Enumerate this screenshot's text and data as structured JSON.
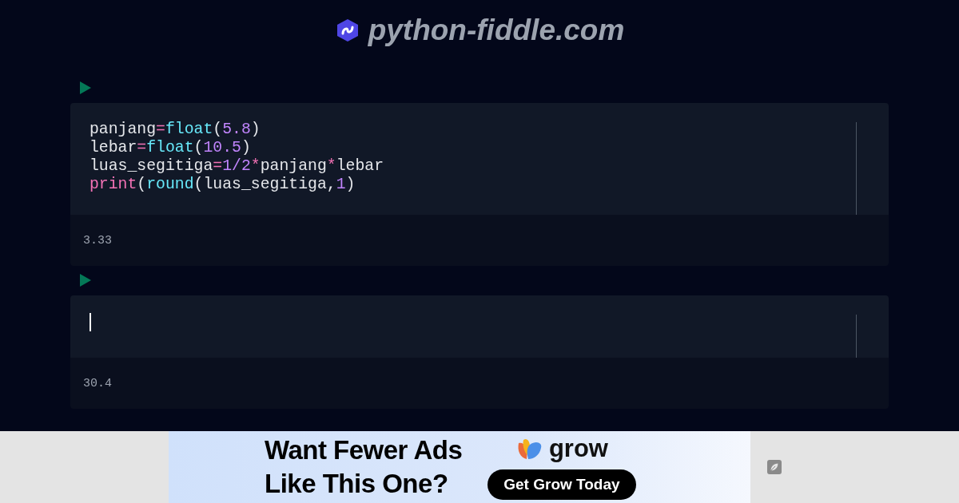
{
  "header": {
    "site_name": "python-fiddle.com"
  },
  "cells": [
    {
      "code": [
        [
          {
            "kind": "plain",
            "text": "panjang"
          },
          {
            "kind": "op",
            "text": "="
          },
          {
            "kind": "fn",
            "text": "float"
          },
          {
            "kind": "plain",
            "text": "("
          },
          {
            "kind": "num",
            "text": "5.8"
          },
          {
            "kind": "plain",
            "text": ")"
          }
        ],
        [
          {
            "kind": "plain",
            "text": "lebar"
          },
          {
            "kind": "op",
            "text": "="
          },
          {
            "kind": "fn",
            "text": "float"
          },
          {
            "kind": "plain",
            "text": "("
          },
          {
            "kind": "num",
            "text": "10.5"
          },
          {
            "kind": "plain",
            "text": ")"
          }
        ],
        [
          {
            "kind": "plain",
            "text": "luas_segitiga"
          },
          {
            "kind": "op",
            "text": "="
          },
          {
            "kind": "num",
            "text": "1/2"
          },
          {
            "kind": "op",
            "text": "*"
          },
          {
            "kind": "plain",
            "text": "panjang"
          },
          {
            "kind": "op",
            "text": "*"
          },
          {
            "kind": "plain",
            "text": "lebar"
          }
        ],
        [
          {
            "kind": "kw",
            "text": "print"
          },
          {
            "kind": "plain",
            "text": "("
          },
          {
            "kind": "fn",
            "text": "round"
          },
          {
            "kind": "plain",
            "text": "(luas_segitiga,"
          },
          {
            "kind": "num",
            "text": "1"
          },
          {
            "kind": "plain",
            "text": ")"
          }
        ]
      ],
      "focused": false,
      "output": "3.33"
    },
    {
      "focused": true,
      "output": "30.4"
    }
  ],
  "ad": {
    "headline": [
      "Want Fewer Ads",
      "Like This One?"
    ],
    "brand": "grow",
    "button": "Get Grow Today"
  }
}
